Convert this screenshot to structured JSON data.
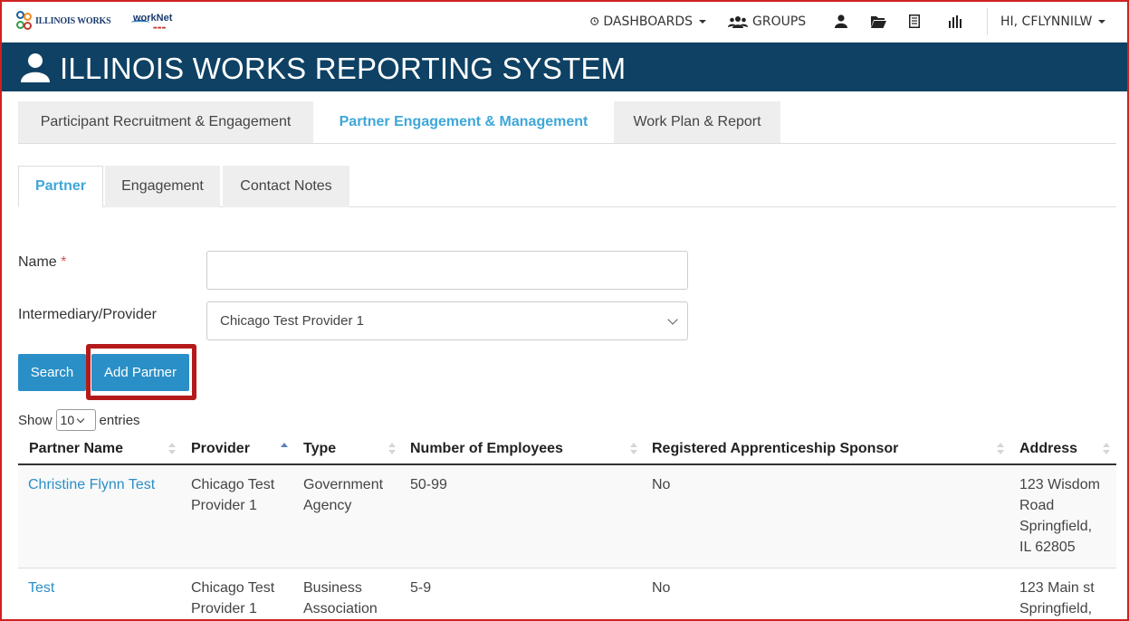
{
  "colors": {
    "banner": "#0e4163",
    "accent": "#2a8fc6",
    "active_tab_text": "#3ea7d8",
    "highlight_box": "#b51a1a",
    "frame": "#d02020"
  },
  "topnav": {
    "logo_illinois_works": "ILLINOIS WORKS",
    "logo_worknet": "workNet",
    "dashboards": "DASHBOARDS",
    "groups": "GROUPS",
    "user_greeting": "HI, CFLYNNILW",
    "icons": [
      "clock-icon",
      "groups-icon",
      "user-icon",
      "folder-icon",
      "document-icon",
      "bar-chart-icon"
    ]
  },
  "banner": {
    "title": "ILLINOIS WORKS REPORTING SYSTEM"
  },
  "main_tabs": [
    {
      "label": "Participant Recruitment & Engagement",
      "active": false
    },
    {
      "label": "Partner Engagement & Management",
      "active": true
    },
    {
      "label": "Work Plan & Report",
      "active": false
    }
  ],
  "sub_tabs": [
    {
      "label": "Partner",
      "active": true
    },
    {
      "label": "Engagement",
      "active": false
    },
    {
      "label": "Contact Notes",
      "active": false
    }
  ],
  "form": {
    "name_label": "Name",
    "required_mark": "*",
    "name_value": "",
    "provider_label": "Intermediary/Provider",
    "provider_value": "Chicago Test Provider 1",
    "search_button": "Search",
    "add_partner_button": "Add Partner"
  },
  "entries": {
    "show": "Show",
    "value": "10",
    "suffix": "entries"
  },
  "table": {
    "columns": [
      "Partner Name",
      "Provider",
      "Type",
      "Number of Employees",
      "Registered Apprenticeship Sponsor",
      "Address"
    ],
    "sorted_column": "Provider",
    "rows": [
      {
        "partner_name": "Christine Flynn Test",
        "provider": [
          "Chicago Test",
          "Provider 1"
        ],
        "type": [
          "Government",
          "Agency"
        ],
        "employees": "50-99",
        "apprenticeship": "No",
        "address": [
          "123 Wisdom",
          "Road",
          "Springfield,",
          "IL 62805"
        ]
      },
      {
        "partner_name": "Test",
        "provider": [
          "Chicago Test",
          "Provider 1"
        ],
        "type": [
          "Business",
          "Association"
        ],
        "employees": "5-9",
        "apprenticeship": "No",
        "address": [
          "123 Main st",
          "Springfield,"
        ]
      }
    ]
  }
}
